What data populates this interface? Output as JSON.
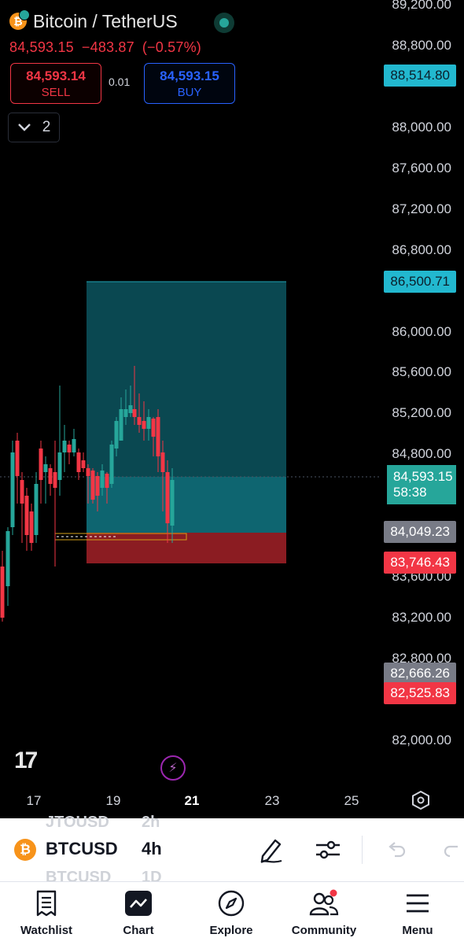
{
  "header": {
    "title": "Bitcoin / TetherUS",
    "last_price": "84,593.15",
    "change": "−483.87",
    "change_pct": "(−0.57%)",
    "sell_price": "84,593.14",
    "sell_label": "SELL",
    "spread": "0.01",
    "buy_price": "84,593.15",
    "buy_label": "BUY",
    "indicators_count": "2"
  },
  "price_scale": {
    "ticks": [
      "89,200.00",
      "88,800.00",
      "88,000.00",
      "87,600.00",
      "87,200.00",
      "86,800.00",
      "86,000.00",
      "85,600.00",
      "85,200.00",
      "84,800.00",
      "83,600.00",
      "83,200.00",
      "82,800.00",
      "82,000.00"
    ],
    "badges": {
      "target_high": "88,514.80",
      "take_profit": "86,500.71",
      "current_price": "84,593.15",
      "countdown": "58:38",
      "entry": "84,049.23",
      "stop_loss": "83,746.43",
      "level_a": "82,666.26",
      "level_b": "82,525.83"
    }
  },
  "time_scale": {
    "ticks": [
      "17",
      "19",
      "21",
      "23",
      "25"
    ],
    "active": "21"
  },
  "symbol_bar": {
    "ghost_prev_symbol": "JTOUSD",
    "ghost_prev_tf": "2h",
    "symbol": "BTCUSD",
    "timeframe": "4h",
    "ghost_next_symbol": "BTCUSD",
    "ghost_next_tf": "1D"
  },
  "nav": {
    "items": [
      {
        "label": "Watchlist",
        "icon": "watchlist-icon"
      },
      {
        "label": "Chart",
        "icon": "chart-icon"
      },
      {
        "label": "Explore",
        "icon": "compass-icon"
      },
      {
        "label": "Community",
        "icon": "community-icon"
      },
      {
        "label": "Menu",
        "icon": "menu-icon"
      }
    ]
  },
  "colors": {
    "up": "#26a69a",
    "down": "#f23645",
    "profit_zone": "#0f5a62",
    "loss_zone": "#8b1c22",
    "accent_blue": "#2962ff"
  }
}
